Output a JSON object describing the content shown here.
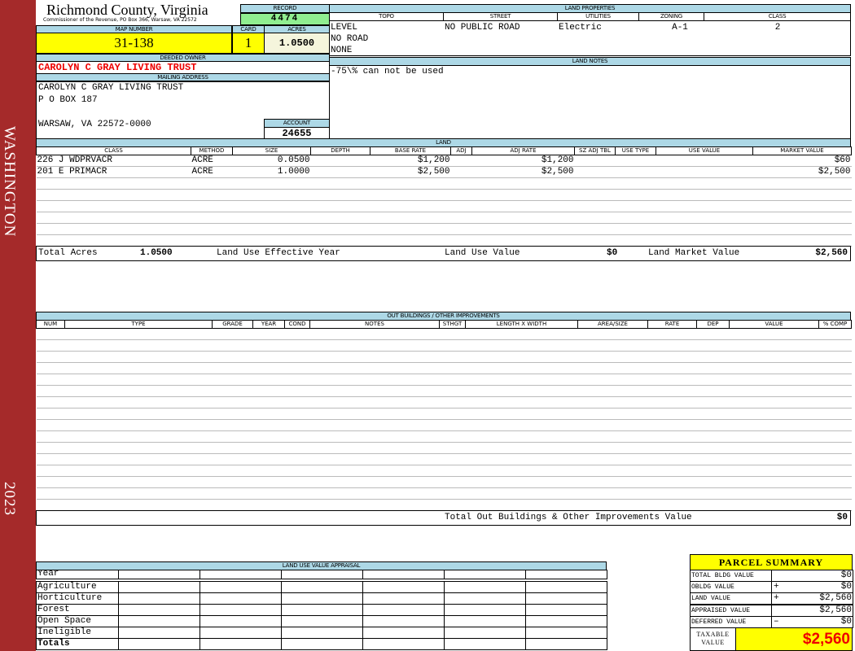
{
  "sidebar": {
    "locality": "WASHINGTON",
    "year": "2023",
    "color": "#a52a2a"
  },
  "header": {
    "title": "Richmond County, Virginia",
    "subtitle": "Commissioner of the Revenue, PO Box 366, Warsaw, VA 22572"
  },
  "record": {
    "label": "RECORD",
    "value": "4474"
  },
  "map": {
    "label": "MAP NUMBER",
    "value": "31-138"
  },
  "card": {
    "label": "CARD",
    "value": "1"
  },
  "acres": {
    "label": "ACRES",
    "value": "1.0500"
  },
  "owner": {
    "label": "DEEDED OWNER",
    "value": "CAROLYN C GRAY LIVING TRUST"
  },
  "mailing": {
    "label": "MAILING ADDRESS",
    "line1": "CAROLYN C GRAY LIVING TRUST",
    "line2": "P O BOX 187",
    "line3": "WARSAW, VA 22572-0000"
  },
  "account": {
    "label": "ACCOUNT",
    "value": "24655"
  },
  "land_properties": {
    "label": "LAND PROPERTIES",
    "headers": [
      "TOPO",
      "STREET",
      "UTILITIES",
      "ZONING",
      "CLASS"
    ],
    "topo": [
      "LEVEL",
      "NO ROAD",
      "NONE"
    ],
    "street": "NO PUBLIC ROAD",
    "utilities": "Electric",
    "zoning": "A-1",
    "class": "2"
  },
  "land_notes": {
    "label": "LAND NOTES",
    "text": "-75\\% can not be used"
  },
  "land": {
    "label": "LAND",
    "headers": [
      "CLASS",
      "METHOD",
      "SIZE",
      "DEPTH",
      "BASE RATE",
      "ADJ",
      "ADJ RATE",
      "SZ ADJ TBL",
      "USE TYPE",
      "USE VALUE",
      "MARKET VALUE"
    ],
    "rows": [
      [
        "226 J WDPRVACR",
        "ACRE",
        "0.0500",
        "",
        "$1,200",
        "",
        "$1,200",
        "",
        "",
        "",
        "$60"
      ],
      [
        "201 E PRIMACR",
        "ACRE",
        "1.0000",
        "",
        "$2,500",
        "",
        "$2,500",
        "",
        "",
        "",
        "$2,500"
      ]
    ],
    "total_acres_label": "Total Acres",
    "total_acres": "1.0500",
    "effective_year_label": "Land Use Effective Year",
    "use_value_label": "Land Use Value",
    "use_value": "$0",
    "market_value_label": "Land Market Value",
    "market_value": "$2,560"
  },
  "outbuildings": {
    "label": "OUT BUILDINGS / OTHER IMPROVEMENTS",
    "headers": [
      "NUM",
      "TYPE",
      "GRADE",
      "YEAR",
      "COND",
      "NOTES",
      "STHGT",
      "LENGTH X WIDTH",
      "AREA/SIZE",
      "RATE",
      "DEP",
      "VALUE",
      "% COMP"
    ],
    "total_label": "Total Out Buildings & Other Improvements Value",
    "total": "$0"
  },
  "land_use_appraisal": {
    "label": "LAND USE VALUE APPRAISAL",
    "year_label": "Year",
    "rows": [
      "Agriculture",
      "Horticulture",
      "Forest",
      "Open Space",
      "Ineligible"
    ],
    "totals_label": "Totals"
  },
  "parcel_summary": {
    "label": "PARCEL SUMMARY",
    "rows": [
      {
        "label": "TOTAL BLDG VALUE",
        "op": "",
        "value": "$0"
      },
      {
        "label": "OBLDG VALUE",
        "op": "+",
        "value": "$0"
      },
      {
        "label": "LAND VALUE",
        "op": "+",
        "value": "$2,560"
      },
      {
        "label": "APPRAISED VALUE",
        "op": "",
        "value": "$2,560"
      },
      {
        "label": "DEFERRED VALUE",
        "op": "–",
        "value": "$0"
      }
    ],
    "taxable_label": "TAXABLE VALUE",
    "taxable": "$2,560"
  }
}
